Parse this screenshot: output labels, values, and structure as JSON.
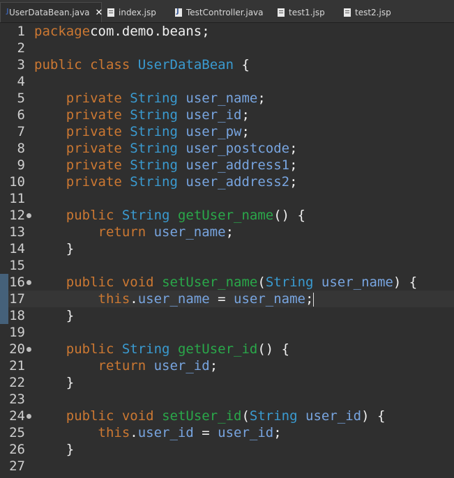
{
  "tabs": [
    {
      "label": "UserDataBean.java",
      "icon": "java-file-icon",
      "active": true,
      "close": "✕"
    },
    {
      "label": "index.jsp",
      "icon": "jsp-file-icon"
    },
    {
      "label": "TestController.java",
      "icon": "java-file-icon"
    },
    {
      "label": "test1.jsp",
      "icon": "jsp-file-icon"
    },
    {
      "label": "test2.jsp",
      "icon": "jsp-file-icon"
    }
  ],
  "editor": {
    "current_line": 17,
    "lines": [
      {
        "n": "1",
        "tokens": [
          [
            "kw",
            "package"
          ],
          [
            "",
            "com.demo.beans;"
          ]
        ]
      },
      {
        "n": "2",
        "tokens": []
      },
      {
        "n": "3",
        "tokens": [
          [
            "kw",
            "public"
          ],
          [
            "",
            " "
          ],
          [
            "kw",
            "class"
          ],
          [
            "",
            " "
          ],
          [
            "cls",
            "UserDataBean"
          ],
          [
            "",
            " {"
          ]
        ]
      },
      {
        "n": "4",
        "tokens": []
      },
      {
        "n": "5",
        "tokens": [
          [
            "",
            "    "
          ],
          [
            "kw",
            "private"
          ],
          [
            "",
            " "
          ],
          [
            "ty",
            "String"
          ],
          [
            "",
            " "
          ],
          [
            "fld",
            "user_name"
          ],
          [
            "",
            ";"
          ]
        ]
      },
      {
        "n": "6",
        "tokens": [
          [
            "",
            "    "
          ],
          [
            "kw",
            "private"
          ],
          [
            "",
            " "
          ],
          [
            "ty",
            "String"
          ],
          [
            "",
            " "
          ],
          [
            "fld",
            "user_id"
          ],
          [
            "",
            ";"
          ]
        ]
      },
      {
        "n": "7",
        "tokens": [
          [
            "",
            "    "
          ],
          [
            "kw",
            "private"
          ],
          [
            "",
            " "
          ],
          [
            "ty",
            "String"
          ],
          [
            "",
            " "
          ],
          [
            "fld",
            "user_pw"
          ],
          [
            "",
            ";"
          ]
        ]
      },
      {
        "n": "8",
        "tokens": [
          [
            "",
            "    "
          ],
          [
            "kw",
            "private"
          ],
          [
            "",
            " "
          ],
          [
            "ty",
            "String"
          ],
          [
            "",
            " "
          ],
          [
            "fld",
            "user_postcode"
          ],
          [
            "",
            ";"
          ]
        ]
      },
      {
        "n": "9",
        "tokens": [
          [
            "",
            "    "
          ],
          [
            "kw",
            "private"
          ],
          [
            "",
            " "
          ],
          [
            "ty",
            "String"
          ],
          [
            "",
            " "
          ],
          [
            "fld",
            "user_address1"
          ],
          [
            "",
            ";"
          ]
        ]
      },
      {
        "n": "10",
        "tokens": [
          [
            "",
            "    "
          ],
          [
            "kw",
            "private"
          ],
          [
            "",
            " "
          ],
          [
            "ty",
            "String"
          ],
          [
            "",
            " "
          ],
          [
            "fld",
            "user_address2"
          ],
          [
            "",
            ";"
          ]
        ]
      },
      {
        "n": "11",
        "tokens": []
      },
      {
        "n": "12",
        "fold": true,
        "tokens": [
          [
            "",
            "    "
          ],
          [
            "kw",
            "public"
          ],
          [
            "",
            " "
          ],
          [
            "ty",
            "String"
          ],
          [
            "",
            " "
          ],
          [
            "mth",
            "getUser_name"
          ],
          [
            "",
            "() {"
          ]
        ]
      },
      {
        "n": "13",
        "tokens": [
          [
            "",
            "        "
          ],
          [
            "kw",
            "return"
          ],
          [
            "",
            " "
          ],
          [
            "fld",
            "user_name"
          ],
          [
            "",
            ";"
          ]
        ]
      },
      {
        "n": "14",
        "tokens": [
          [
            "",
            "    }"
          ]
        ]
      },
      {
        "n": "15",
        "tokens": []
      },
      {
        "n": "16",
        "fold": true,
        "marker": true,
        "tokens": [
          [
            "",
            "    "
          ],
          [
            "kw",
            "public"
          ],
          [
            "",
            " "
          ],
          [
            "kw",
            "void"
          ],
          [
            "",
            " "
          ],
          [
            "mth",
            "setUser_name"
          ],
          [
            "",
            "("
          ],
          [
            "ty",
            "String"
          ],
          [
            "",
            " "
          ],
          [
            "fld",
            "user_name"
          ],
          [
            "",
            ") {"
          ]
        ]
      },
      {
        "n": "17",
        "marker": true,
        "tokens": [
          [
            "",
            "        "
          ],
          [
            "kw",
            "this"
          ],
          [
            "",
            "."
          ],
          [
            "fld",
            "user_name"
          ],
          [
            "",
            " = "
          ],
          [
            "fld",
            "user_name"
          ],
          [
            "",
            ";"
          ]
        ]
      },
      {
        "n": "18",
        "marker": true,
        "tokens": [
          [
            "",
            "    }"
          ]
        ]
      },
      {
        "n": "19",
        "tokens": []
      },
      {
        "n": "20",
        "fold": true,
        "tokens": [
          [
            "",
            "    "
          ],
          [
            "kw",
            "public"
          ],
          [
            "",
            " "
          ],
          [
            "ty",
            "String"
          ],
          [
            "",
            " "
          ],
          [
            "mth",
            "getUser_id"
          ],
          [
            "",
            "() {"
          ]
        ]
      },
      {
        "n": "21",
        "tokens": [
          [
            "",
            "        "
          ],
          [
            "kw",
            "return"
          ],
          [
            "",
            " "
          ],
          [
            "fld",
            "user_id"
          ],
          [
            "",
            ";"
          ]
        ]
      },
      {
        "n": "22",
        "tokens": [
          [
            "",
            "    }"
          ]
        ]
      },
      {
        "n": "23",
        "tokens": []
      },
      {
        "n": "24",
        "fold": true,
        "tokens": [
          [
            "",
            "    "
          ],
          [
            "kw",
            "public"
          ],
          [
            "",
            " "
          ],
          [
            "kw",
            "void"
          ],
          [
            "",
            " "
          ],
          [
            "mth",
            "setUser_id"
          ],
          [
            "",
            "("
          ],
          [
            "ty",
            "String"
          ],
          [
            "",
            " "
          ],
          [
            "fld",
            "user_id"
          ],
          [
            "",
            ") {"
          ]
        ]
      },
      {
        "n": "25",
        "tokens": [
          [
            "",
            "        "
          ],
          [
            "kw",
            "this"
          ],
          [
            "",
            "."
          ],
          [
            "fld",
            "user_id"
          ],
          [
            "",
            " = "
          ],
          [
            "fld",
            "user_id"
          ],
          [
            "",
            ";"
          ]
        ]
      },
      {
        "n": "26",
        "tokens": [
          [
            "",
            "    }"
          ]
        ]
      },
      {
        "n": "27",
        "tokens": []
      }
    ]
  }
}
